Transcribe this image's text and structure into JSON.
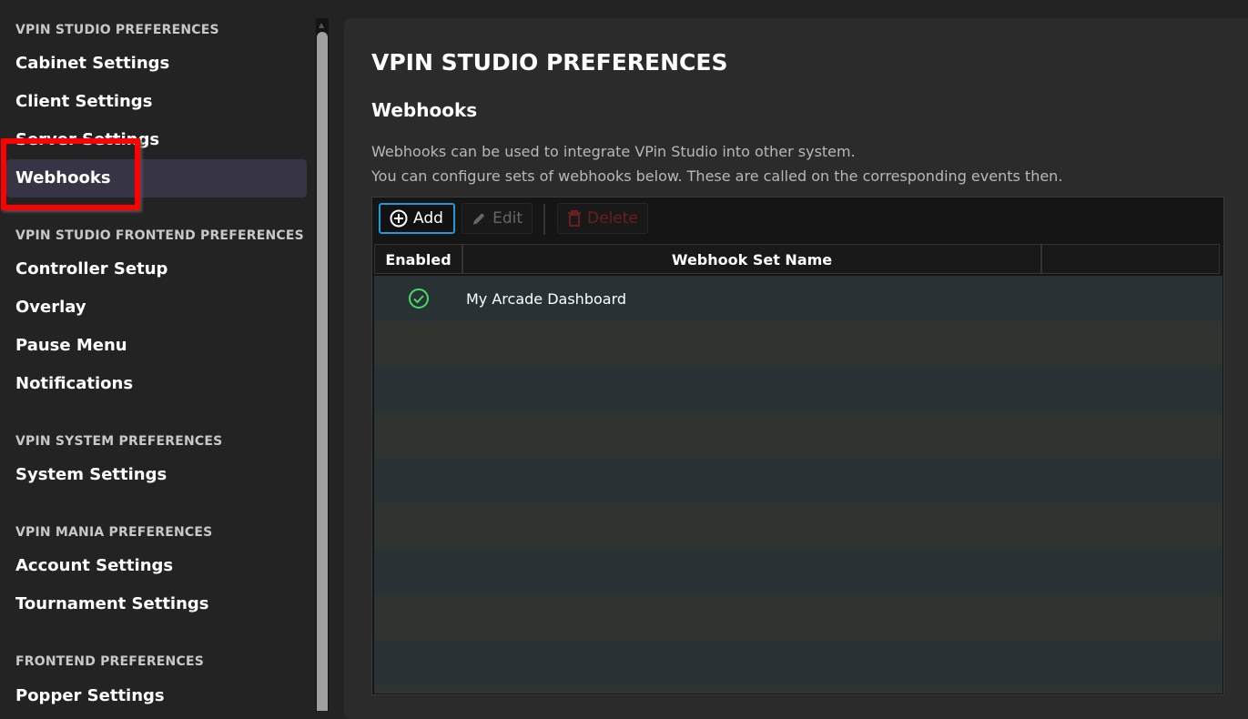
{
  "sidebar": {
    "sections": [
      {
        "title": "VPIN STUDIO PREFERENCES",
        "items": [
          "Cabinet Settings",
          "Client Settings",
          "Server Settings",
          "Webhooks"
        ]
      },
      {
        "title": "VPIN STUDIO FRONTEND PREFERENCES",
        "items": [
          "Controller Setup",
          "Overlay",
          "Pause Menu",
          "Notifications"
        ]
      },
      {
        "title": "VPIN SYSTEM PREFERENCES",
        "items": [
          "System Settings"
        ]
      },
      {
        "title": "VPIN MANIA PREFERENCES",
        "items": [
          "Account Settings",
          "Tournament Settings"
        ]
      },
      {
        "title": "FRONTEND PREFERENCES",
        "items": [
          "Popper Settings"
        ]
      }
    ],
    "selected": "Webhooks"
  },
  "main": {
    "title": "VPIN STUDIO PREFERENCES",
    "subtitle": "Webhooks",
    "description": [
      "Webhooks can be used to integrate VPin Studio into other system.",
      "You can configure sets of webhooks below. These are called on the corresponding events then."
    ],
    "toolbar": {
      "add": "Add",
      "edit": "Edit",
      "delete": "Delete"
    },
    "table": {
      "columns": [
        "Enabled",
        "Webhook Set Name",
        ""
      ],
      "rows": [
        {
          "enabled": true,
          "name": "My Arcade Dashboard"
        }
      ]
    }
  },
  "colors": {
    "accent": "#1e9ad6",
    "selected_bg": "#363445",
    "enabled_icon": "#4cd964",
    "highlight_box": "#ff0000"
  }
}
